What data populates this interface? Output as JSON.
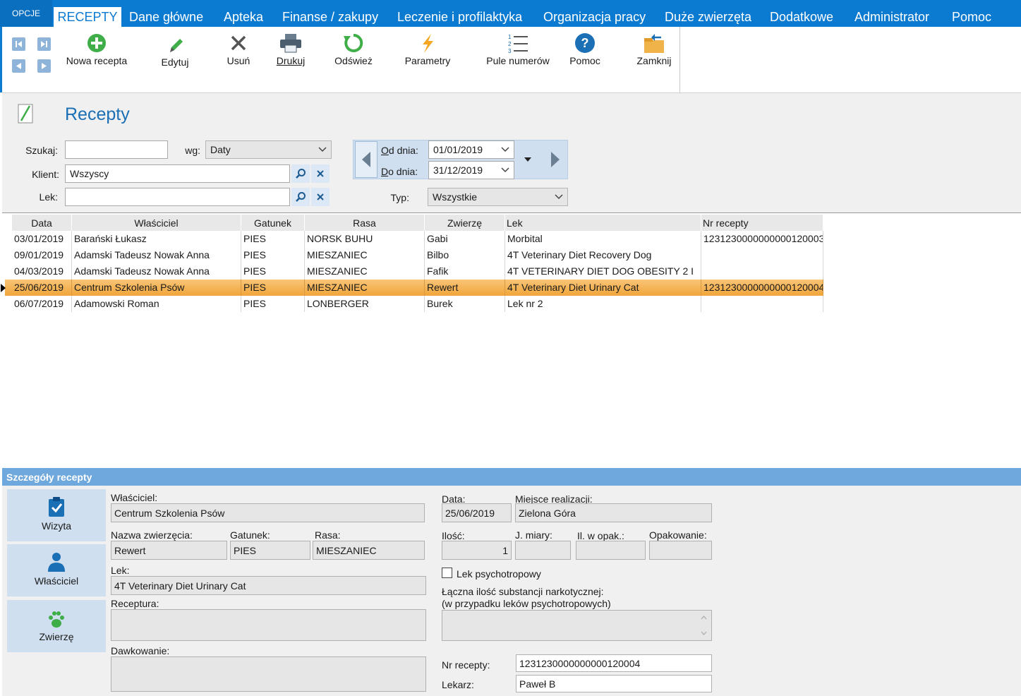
{
  "menu": {
    "opcje": "OPCJE",
    "active_tab": "RECEPTY",
    "items": [
      "Dane główne",
      "Apteka",
      "Finanse / zakupy",
      "Leczenie i profilaktyka",
      "Organizacja pracy",
      "Duże zwierzęta",
      "Dodatkowe",
      "Administrator",
      "Pomoc"
    ]
  },
  "ribbon": {
    "new": "Nowa recepta",
    "edit": "Edytuj",
    "delete": "Usuń",
    "print": "Drukuj",
    "refresh": "Odśwież",
    "params": "Parametry",
    "pools": "Pule numerów",
    "help": "Pomoc",
    "close": "Zamknij"
  },
  "page": {
    "title": "Recepty"
  },
  "filters": {
    "search_label": "Szukaj:",
    "search_value": "",
    "by_label": "wg:",
    "by_value": "Daty",
    "client_label": "Klient:",
    "client_value": "Wszyscy",
    "drug_label": "Lek:",
    "drug_value": "",
    "from_label": "Od dnia:",
    "from_value": "01/01/2019",
    "to_label": "Do dnia:",
    "to_value": "31/12/2019",
    "type_label": "Typ:",
    "type_value": "Wszystkie"
  },
  "grid": {
    "columns": [
      "Data",
      "Właściciel",
      "Gatunek",
      "Rasa",
      "Zwierzę",
      "Lek",
      "Nr recepty"
    ],
    "rows": [
      [
        "03/01/2019",
        "Barański Łukasz",
        "PIES",
        "NORSK BUHU",
        "Gabi",
        "Morbital",
        "123123000000000012000З"
      ],
      [
        "09/01/2019",
        "Adamski Tadeusz Nowak Anna",
        "PIES",
        "MIESZANIEC",
        "Bilbo",
        "4T Veterinary Diet Recovery Dog",
        ""
      ],
      [
        "04/03/2019",
        "Adamski Tadeusz Nowak Anna",
        "PIES",
        "MIESZANIEC",
        "Fafik",
        "4T VETERINARY DIET DOG OBESITY 2 I",
        ""
      ],
      [
        "25/06/2019",
        "Centrum Szkolenia Psów",
        "PIES",
        "MIESZANIEC",
        "Rewert",
        "4T Veterinary Diet Urinary Cat",
        "1231230000000000120004"
      ],
      [
        "06/07/2019",
        "Adamowski Roman",
        "PIES",
        "LONBERGER",
        "Burek",
        "Lek nr 2",
        ""
      ]
    ],
    "selected_index": 3
  },
  "details": {
    "header": "Szczegóły recepty",
    "side": {
      "visit": "Wizyta",
      "owner": "Właściciel",
      "animal": "Zwierzę"
    },
    "owner_label": "Właściciel:",
    "owner_value": "Centrum Szkolenia Psów",
    "animal_label": "Nazwa zwierzęcia:",
    "animal_value": "Rewert",
    "species_label": "Gatunek:",
    "species_value": "PIES",
    "breed_label": "Rasa:",
    "breed_value": "MIESZANIEC",
    "drug_label": "Lek:",
    "drug_value": "4T Veterinary Diet Urinary Cat",
    "recipe_label": "Receptura:",
    "recipe_value": "",
    "dosage_label": "Dawkowanie:",
    "dosage_value": "",
    "date_label": "Data:",
    "date_value": "25/06/2019",
    "place_label": "Miejsce realizacji:",
    "place_value": "Zielona Góra",
    "qty_label": "Ilość:",
    "qty_value": "1",
    "unit_label": "J. miary:",
    "unit_value": "",
    "perpack_label": "Il. w opak.:",
    "perpack_value": "",
    "pack_label": "Opakowanie:",
    "pack_value": "",
    "psycho_label": "Lek psychotropowy",
    "psycho_checked": false,
    "narc_label1": "Łączna ilość substancji narkotycznej:",
    "narc_label2": "(w przypadku leków psychotropowych)",
    "narc_value": "",
    "nr_label": "Nr recepty:",
    "nr_value": "1231230000000000120004",
    "doctor_label": "Lekarz:",
    "doctor_value": "Paweł B"
  }
}
